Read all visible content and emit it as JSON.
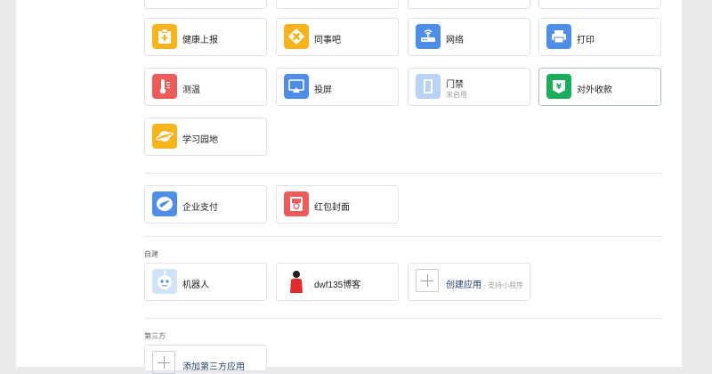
{
  "colors": {
    "yellow": "#f7b319",
    "blue": "#4f8ee8",
    "red": "#ef5b5b",
    "green": "#1aad5c",
    "pale_blue": "#b8d3f5"
  },
  "apps_grid": [
    {
      "label": "健康上报",
      "icon": "health-report-icon"
    },
    {
      "label": "同事吧",
      "icon": "colleague-icon"
    },
    {
      "label": "网络",
      "icon": "network-icon"
    },
    {
      "label": "打印",
      "icon": "printer-icon"
    },
    {
      "label": "测温",
      "icon": "thermometer-icon"
    },
    {
      "label": "投屏",
      "icon": "screen-cast-icon"
    },
    {
      "label": "门禁",
      "sub": "未启用",
      "icon": "door-access-icon"
    },
    {
      "label": "对外收款",
      "icon": "payment-icon"
    },
    {
      "label": "学习园地",
      "icon": "study-icon"
    }
  ],
  "finance_apps": [
    {
      "label": "企业支付",
      "icon": "enterprise-pay-icon"
    },
    {
      "label": "红包封面",
      "icon": "red-packet-icon"
    }
  ],
  "custom_section": {
    "title": "自建",
    "items": [
      {
        "label": "机器人",
        "icon": "robot-avatar-icon"
      },
      {
        "label": "dwf135博客",
        "icon": "blog-avatar-icon"
      }
    ],
    "create_app": {
      "label": "创建应用",
      "hint": " · 支持小程序"
    }
  },
  "third_party_section": {
    "title": "第三方",
    "add_app": {
      "label": "添加第三方应用"
    }
  }
}
